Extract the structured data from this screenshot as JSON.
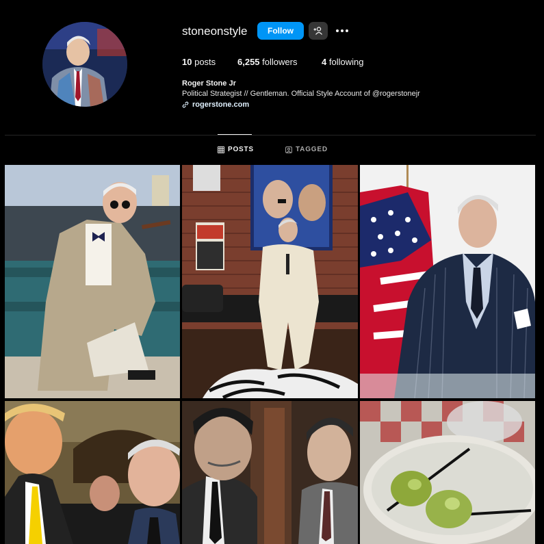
{
  "profile": {
    "username": "stoneonstyle",
    "follow_label": "Follow",
    "stats": {
      "posts_count": "10",
      "posts_label": "posts",
      "followers_count": "6,255",
      "followers_label": "followers",
      "following_count": "4",
      "following_label": "following"
    },
    "full_name": "Roger Stone Jr",
    "bio": "Political Strategist // Gentleman. Official Style Account of @rogerstonejr",
    "link": "rogerstone.com"
  },
  "tabs": [
    {
      "label": "POSTS",
      "icon": "grid-icon",
      "active": true
    },
    {
      "label": "TAGGED",
      "icon": "tag-icon",
      "active": false
    }
  ],
  "posts": [
    {
      "subject": "man in tan plaid jacket with cigar on bench"
    },
    {
      "subject": "man in white suit in front of portrait painting"
    },
    {
      "subject": "man in pinstripe suit by american flag"
    },
    {
      "subject": "two men smiling at event"
    },
    {
      "subject": "black and white archival photo of two men"
    },
    {
      "subject": "martini with olives on checkered tablecloth"
    }
  ],
  "colors": {
    "background": "#000000",
    "follow_button": "#0095f6",
    "secondary_button": "#363636",
    "text": "#f5f5f5"
  }
}
